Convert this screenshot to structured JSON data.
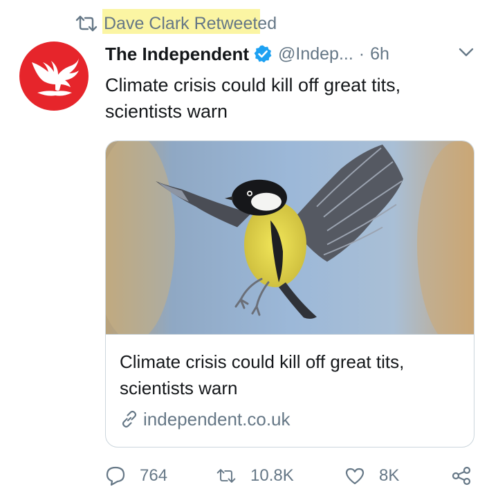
{
  "retweet": {
    "text": "Dave Clark Retweeted",
    "icon": "retweet-icon"
  },
  "author": {
    "name": "The Independent",
    "handle": "@Indep...",
    "separator": "·",
    "time": "6h",
    "verified": true,
    "avatar_color": "#e6252b"
  },
  "tweet": {
    "text": "Climate crisis could kill off great tits, scientists warn"
  },
  "card": {
    "title": "Climate crisis could kill off great tits, scientists warn",
    "domain": "independent.co.uk",
    "image_subject": "great tit bird in flight"
  },
  "actions": {
    "reply_count": "764",
    "retweet_count": "10.8K",
    "like_count": "8K"
  },
  "colors": {
    "text": "#14171a",
    "secondary": "#657786",
    "verified": "#1da1f2",
    "border": "#ccd6dd",
    "highlight": "#fbf5a3"
  }
}
